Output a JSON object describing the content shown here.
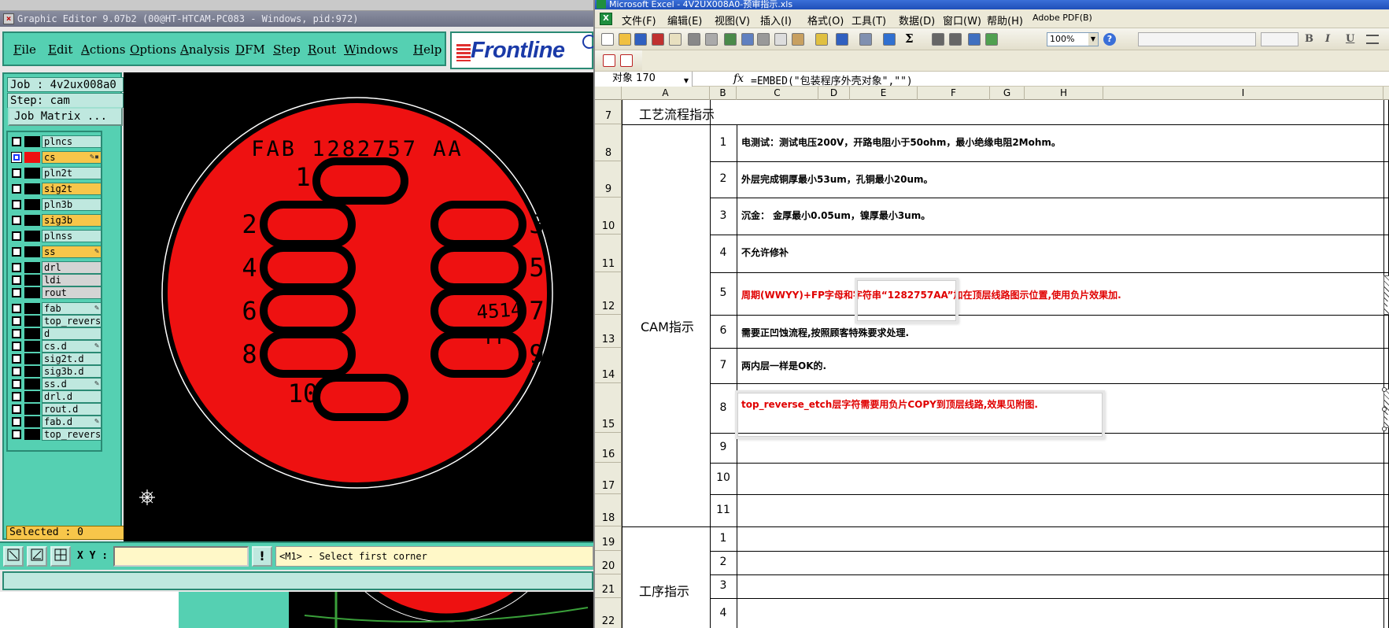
{
  "genesis": {
    "title": "Graphic Editor 9.07b2 (00@HT-HTCAM-PC083 - Windows, pid:972)",
    "menu": [
      {
        "id": "file",
        "label": "File"
      },
      {
        "id": "edit",
        "label": "Edit"
      },
      {
        "id": "actions",
        "label": "Actions"
      },
      {
        "id": "options",
        "label": "Options"
      },
      {
        "id": "analysis",
        "label": "Analysis"
      },
      {
        "id": "dfm",
        "label": "DFM"
      },
      {
        "id": "step",
        "label": "Step"
      },
      {
        "id": "rout",
        "label": "Rout"
      },
      {
        "id": "windows",
        "label": "Windows"
      },
      {
        "id": "help",
        "label": "Help"
      }
    ],
    "logo_text": "Frontline",
    "job": "Job : 4v2ux008a0",
    "step": "Step: cam",
    "job_matrix_label": "Job Matrix ...",
    "layers": [
      {
        "name": "plncs",
        "kind": "plane",
        "mark": ""
      },
      {
        "name": "cs",
        "kind": "sig",
        "mark": "✎▪",
        "active": true
      },
      {
        "name": "pln2t",
        "kind": "plane",
        "mark": ""
      },
      {
        "name": "sig2t",
        "kind": "sig",
        "mark": ""
      },
      {
        "name": "pln3b",
        "kind": "plane",
        "mark": ""
      },
      {
        "name": "sig3b",
        "kind": "sig",
        "mark": ""
      },
      {
        "name": "plnss",
        "kind": "plane",
        "mark": ""
      },
      {
        "name": "ss",
        "kind": "sig",
        "mark": "✎"
      },
      {
        "name": "drl",
        "kind": "gray",
        "mark": ""
      },
      {
        "name": "ldi",
        "kind": "gray",
        "mark": ""
      },
      {
        "name": "rout",
        "kind": "gray",
        "mark": ""
      },
      {
        "name": "fab",
        "kind": "plane",
        "mark": "✎"
      },
      {
        "name": "top_reverse_",
        "kind": "plane",
        "mark": ""
      },
      {
        "name": "d",
        "kind": "plane",
        "mark": ""
      },
      {
        "name": "cs.d",
        "kind": "plane",
        "mark": "✎"
      },
      {
        "name": "sig2t.d",
        "kind": "plane",
        "mark": ""
      },
      {
        "name": "sig3b.d",
        "kind": "plane",
        "mark": ""
      },
      {
        "name": "ss.d",
        "kind": "plane",
        "mark": "✎"
      },
      {
        "name": "drl.d",
        "kind": "plane",
        "mark": ""
      },
      {
        "name": "rout.d",
        "kind": "plane",
        "mark": ""
      },
      {
        "name": "fab.d",
        "kind": "plane",
        "mark": "✎"
      },
      {
        "name": "top_reverse_",
        "kind": "plane",
        "mark": ""
      }
    ],
    "selected": "Selected : 0",
    "canvas": {
      "fab_text": "FAB 1282757 AA",
      "pad_numbers": [
        "1",
        "2",
        "3",
        "4",
        "5",
        "6",
        "7",
        "8",
        "9",
        "10"
      ],
      "date_code": "4514",
      "fp_text": "FP",
      "colors": {
        "copper": "#ee1111",
        "background": "#000000",
        "outline": "#ffffff"
      }
    },
    "xy_label": "X Y :",
    "xy_value": "",
    "status": "<M1> - Select first corner"
  },
  "excel": {
    "title": "Microsoft Excel - 4V2UX008A0-预审指示.xls",
    "menu": [
      {
        "id": "file",
        "label": "文件(F)"
      },
      {
        "id": "edit",
        "label": "编辑(E)"
      },
      {
        "id": "view",
        "label": "视图(V)"
      },
      {
        "id": "insert",
        "label": "插入(I)"
      },
      {
        "id": "format",
        "label": "格式(O)"
      },
      {
        "id": "tools",
        "label": "工具(T)"
      },
      {
        "id": "data",
        "label": "数据(D)"
      },
      {
        "id": "window",
        "label": "窗口(W)"
      },
      {
        "id": "help",
        "label": "帮助(H)"
      },
      {
        "id": "pdf",
        "label": "Adobe PDF(B)"
      }
    ],
    "zoom": "100%",
    "name_box": "对象 170",
    "fx": "fx",
    "formula": "=EMBED(\"包装程序外壳对象\",\"\")",
    "columns": [
      "A",
      "B",
      "C",
      "D",
      "E",
      "F",
      "G",
      "H",
      "I",
      "J"
    ],
    "row_numbers": [
      "7",
      "8",
      "9",
      "10",
      "11",
      "12",
      "13",
      "14",
      "15",
      "16",
      "17",
      "18",
      "19",
      "20",
      "21",
      "22"
    ],
    "header_cell": "工艺流程指示",
    "cam_label": "CAM指示",
    "process_label": "工序指示",
    "cam_items": [
      {
        "no": "1",
        "text": "电测试：测试电压200V，开路电阻小于50ohm，最小绝缘电阻2Mohm。",
        "red": false
      },
      {
        "no": "2",
        "text": "外层完成铜厚最小53um，孔铜最小20um。",
        "red": false
      },
      {
        "no": "3",
        "text": "沉金： 金厚最小0.05um，镍厚最小3um。",
        "red": false
      },
      {
        "no": "4",
        "text": "不允许修补",
        "red": false
      },
      {
        "no": "5",
        "text": "周期(WWYY)+FP字母和字符串“1282757AA”加在顶层线路图示位置,使用负片效果加.",
        "red": true
      },
      {
        "no": "6",
        "text": "需要正凹蚀流程,按照顾客特殊要求处理.",
        "red": false
      },
      {
        "no": "7",
        "text": "两内层一样是OK的.",
        "red": false
      },
      {
        "no": "8",
        "text": "top_reverse_etch层字符需要用负片COPY到顶层线路,效果见附图.",
        "red": true
      },
      {
        "no": "9",
        "text": "",
        "red": false
      },
      {
        "no": "10",
        "text": "",
        "red": false
      },
      {
        "no": "11",
        "text": "",
        "red": false
      }
    ],
    "process_items": [
      {
        "no": "1"
      },
      {
        "no": "2"
      },
      {
        "no": "3"
      },
      {
        "no": "4"
      }
    ],
    "objects": [
      {
        "label": "11.jpg"
      },
      {
        "label": "33.jpg"
      }
    ]
  }
}
